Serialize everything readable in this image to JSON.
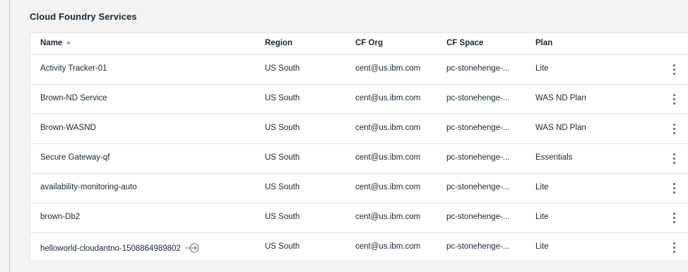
{
  "section": {
    "title": "Cloud Foundry Services"
  },
  "table": {
    "columns": {
      "name": "Name",
      "region": "Region",
      "org": "CF Org",
      "space": "CF Space",
      "plan": "Plan"
    },
    "sort": {
      "column": "name",
      "direction": "ascending",
      "icon": "sort-ascending-icon"
    },
    "rows": [
      {
        "name": "Activity Tracker-01",
        "region": "US South",
        "org": "cent@us.ibm.com",
        "space": "pc-stonehenge-...",
        "plan": "Lite"
      },
      {
        "name": "Brown-ND Service",
        "region": "US South",
        "org": "cent@us.ibm.com",
        "space": "pc-stonehenge-...",
        "plan": "WAS ND Plan"
      },
      {
        "name": "Brown-WASND",
        "region": "US South",
        "org": "cent@us.ibm.com",
        "space": "pc-stonehenge-...",
        "plan": "WAS ND Plan"
      },
      {
        "name": "Secure Gateway-qf",
        "region": "US South",
        "org": "cent@us.ibm.com",
        "space": "pc-stonehenge-...",
        "plan": "Essentials"
      },
      {
        "name": "availability-monitoring-auto",
        "region": "US South",
        "org": "cent@us.ibm.com",
        "space": "pc-stonehenge-...",
        "plan": "Lite"
      },
      {
        "name": "brown-Db2",
        "region": "US South",
        "org": "cent@us.ibm.com",
        "space": "pc-stonehenge-...",
        "plan": "Lite"
      },
      {
        "name": "helloworld-cloudantno-1508864989802",
        "region": "US South",
        "org": "cent@us.ibm.com",
        "space": "pc-stonehenge-...",
        "plan": "Lite",
        "icon": "launch-link-icon"
      }
    ]
  },
  "colors": {
    "background": "#f3f3f3",
    "table_background": "#ffffff",
    "border": "#dfe3e6",
    "text": "#152935",
    "icon": "#5a6872"
  }
}
